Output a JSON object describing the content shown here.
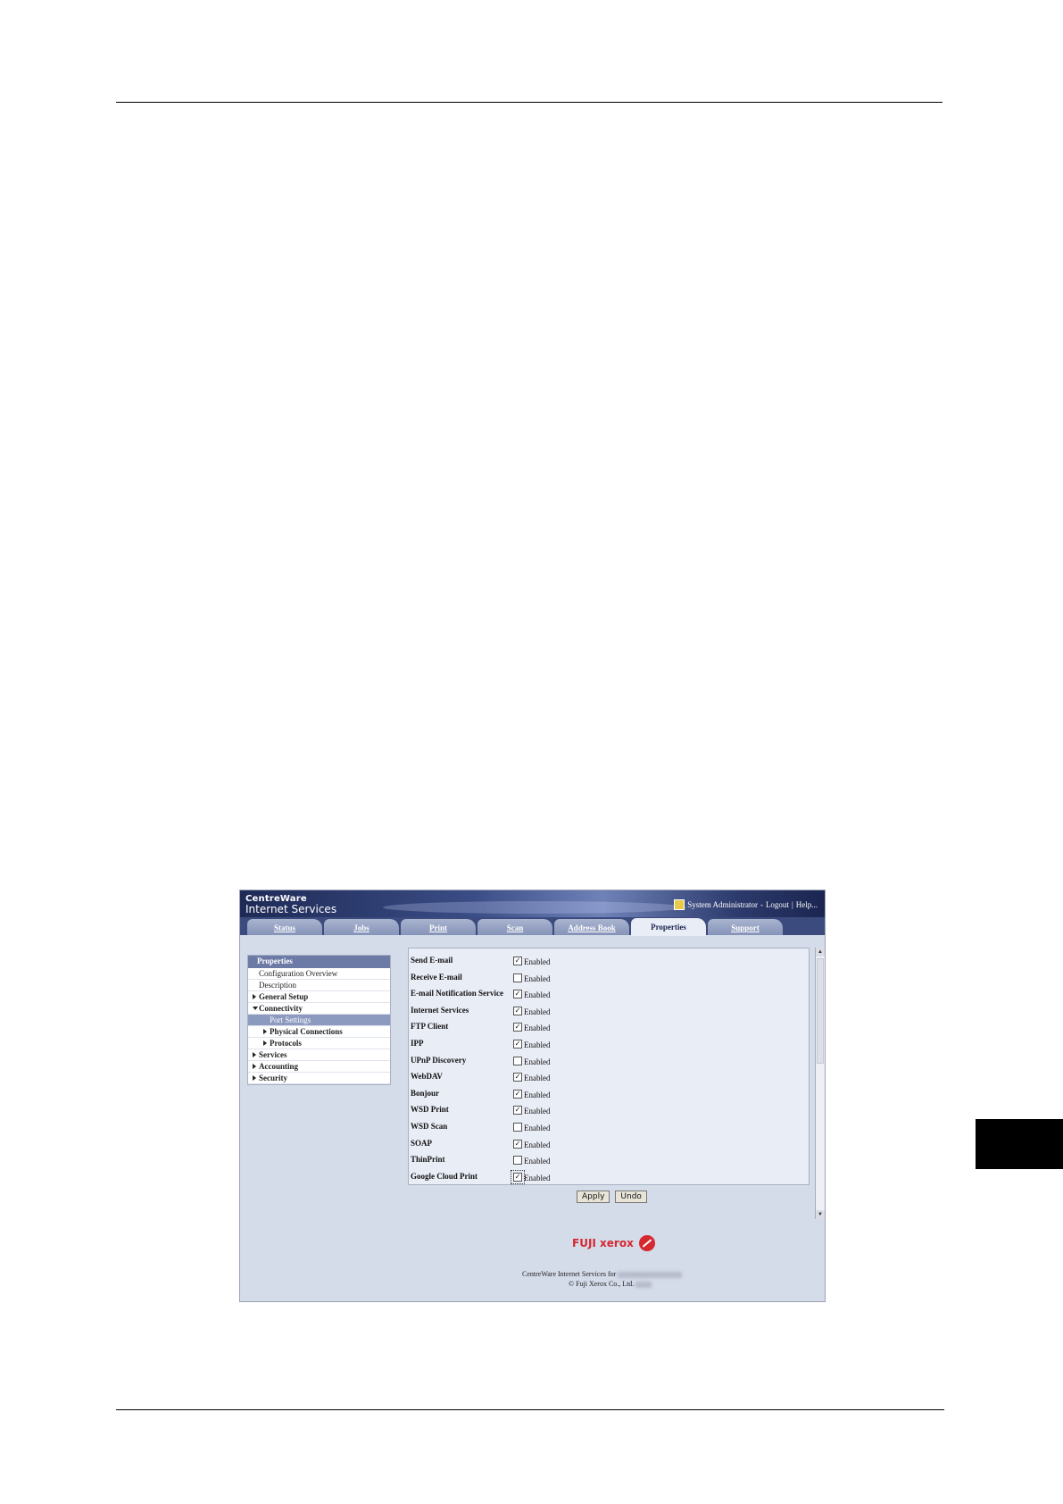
{
  "app": {
    "brand_line1": "CentreWare",
    "brand_line2": "Internet Services",
    "admin_label": "System Administrator",
    "logout_label": "Logout",
    "help_label": "Help..."
  },
  "tabs": [
    {
      "label": "Status"
    },
    {
      "label": "Jobs"
    },
    {
      "label": "Print"
    },
    {
      "label": "Scan"
    },
    {
      "label": "Address Book"
    },
    {
      "label": "Properties",
      "active": true
    },
    {
      "label": "Support"
    }
  ],
  "sidebar": {
    "header": "Properties",
    "items": [
      {
        "label": "Configuration Overview"
      },
      {
        "label": "Description"
      },
      {
        "label": "General Setup"
      },
      {
        "label": "Connectivity"
      },
      {
        "label": "Port Settings"
      },
      {
        "label": "Physical Connections"
      },
      {
        "label": "Protocols"
      },
      {
        "label": "Services"
      },
      {
        "label": "Accounting"
      },
      {
        "label": "Security"
      }
    ]
  },
  "ports": [
    {
      "name": "Send E-mail",
      "enabled": true
    },
    {
      "name": "Receive E-mail",
      "enabled": false
    },
    {
      "name": "E-mail Notification Service",
      "enabled": true
    },
    {
      "name": "Internet Services",
      "enabled": true
    },
    {
      "name": "FTP Client",
      "enabled": true
    },
    {
      "name": "IPP",
      "enabled": true
    },
    {
      "name": "UPnP Discovery",
      "enabled": false
    },
    {
      "name": "WebDAV",
      "enabled": true
    },
    {
      "name": "Bonjour",
      "enabled": true
    },
    {
      "name": "WSD Print",
      "enabled": true
    },
    {
      "name": "WSD Scan",
      "enabled": false
    },
    {
      "name": "SOAP",
      "enabled": true
    },
    {
      "name": "ThinPrint",
      "enabled": false
    },
    {
      "name": "Google Cloud Print",
      "enabled": true
    }
  ],
  "enabled_label": "Enabled",
  "buttons": {
    "apply": "Apply",
    "undo": "Undo"
  },
  "logo_text": "FUJI xerox",
  "footer": {
    "line1": "CentreWare Internet Services for",
    "line2": "© Fuji Xerox Co., Ltd."
  }
}
